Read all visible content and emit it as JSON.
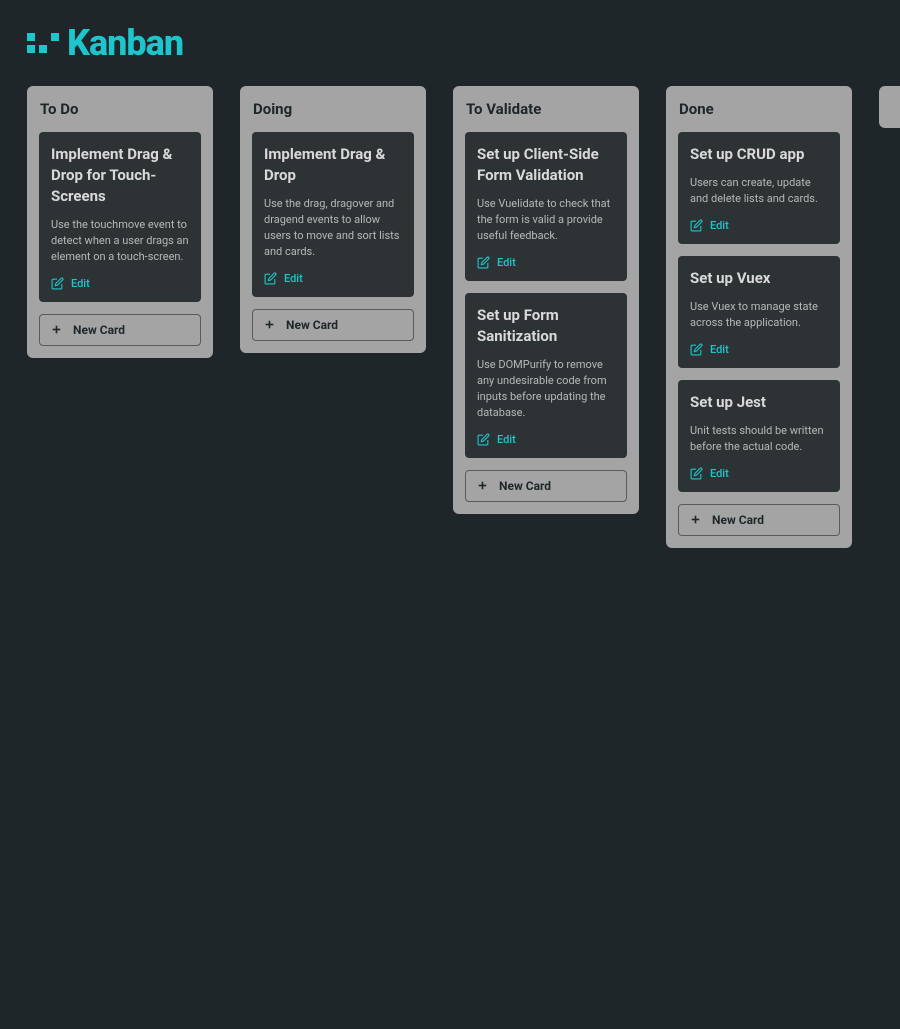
{
  "logo": "Kanban",
  "accent_color": "#1dc6cc",
  "new_card_label": "New Card",
  "edit_label": "Edit",
  "lists": [
    {
      "title": "To Do",
      "cards": [
        {
          "title": "Implement Drag & Drop for Touch-Screens",
          "desc": "Use the touchmove event to detect when a user drags an element on a touch-screen."
        }
      ]
    },
    {
      "title": "Doing",
      "cards": [
        {
          "title": "Implement Drag & Drop",
          "desc": "Use the drag, dragover and dragend events to allow users to move and sort lists and cards."
        }
      ]
    },
    {
      "title": "To Validate",
      "cards": [
        {
          "title": "Set up Client-Side Form Validation",
          "desc": "Use Vuelidate to check that the form is valid a provide useful feedback."
        },
        {
          "title": "Set up Form Sanitization",
          "desc": "Use DOMPurify to remove any undesirable code from inputs before updating the database."
        }
      ]
    },
    {
      "title": "Done",
      "cards": [
        {
          "title": "Set up CRUD app",
          "desc": "Users can create, update and delete lists and cards."
        },
        {
          "title": "Set up Vuex",
          "desc": "Use Vuex to manage state across the application."
        },
        {
          "title": "Set up Jest",
          "desc": "Unit tests should be written before the actual code."
        }
      ]
    }
  ]
}
